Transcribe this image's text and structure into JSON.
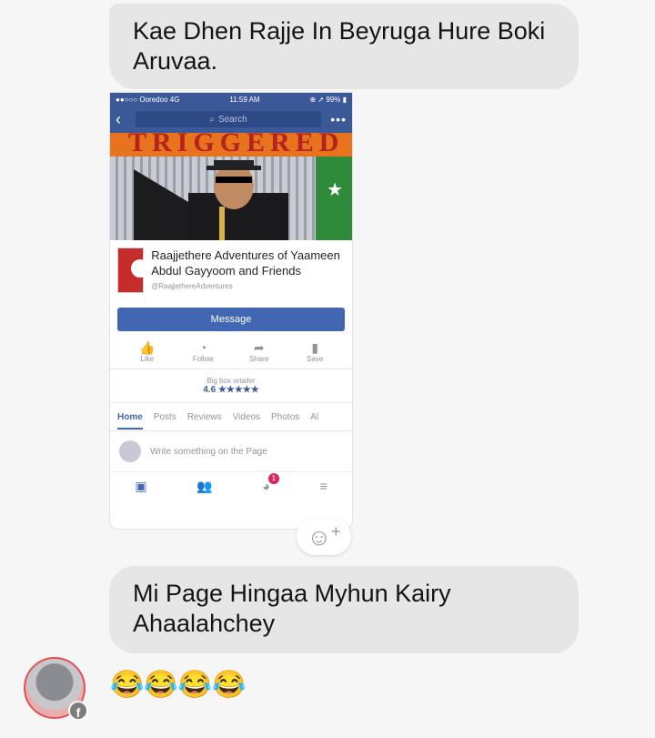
{
  "messages": {
    "first": "Kae Dhen Rajje In Beyruga Hure Boki Aruvaa.",
    "second": "Mi Page Hingaa Myhun Kairy Ahaalahchey",
    "third_emojis": "😂😂😂😂"
  },
  "phone": {
    "carrier": "●●○○○ Ooredoo  4G",
    "time": "11:59 AM",
    "battery": "⊕ ➚ 99% ▮",
    "search_placeholder": "Search",
    "banner_text": "TRIGGERED",
    "page_name": "Raajjethere Adventures of Yaameen Abdul Gayyoom and Friends",
    "page_handle": "@RaajjethereAdventures",
    "message_button": "Message",
    "actions": [
      "Like",
      "Follow",
      "Share",
      "Save"
    ],
    "category": "Big box retailer",
    "rating": "4.6 ★★★★★",
    "tabs": [
      "Home",
      "Posts",
      "Reviews",
      "Videos",
      "Photos",
      "Al"
    ],
    "compose_placeholder": "Write something on the Page",
    "notification_count": "1"
  },
  "icons": {
    "back": "chevron-left-icon",
    "search": "search-icon",
    "more": "more-dots-icon",
    "like": "thumbs-up-icon",
    "follow": "rss-icon",
    "share": "share-arrow-icon",
    "save": "bookmark-icon",
    "react": "add-reaction-icon",
    "messenger_badge": "facebook-icon"
  },
  "colors": {
    "fb_blue": "#3b5998",
    "bubble": "#e6e6e6",
    "background": "#f6f6f6"
  }
}
